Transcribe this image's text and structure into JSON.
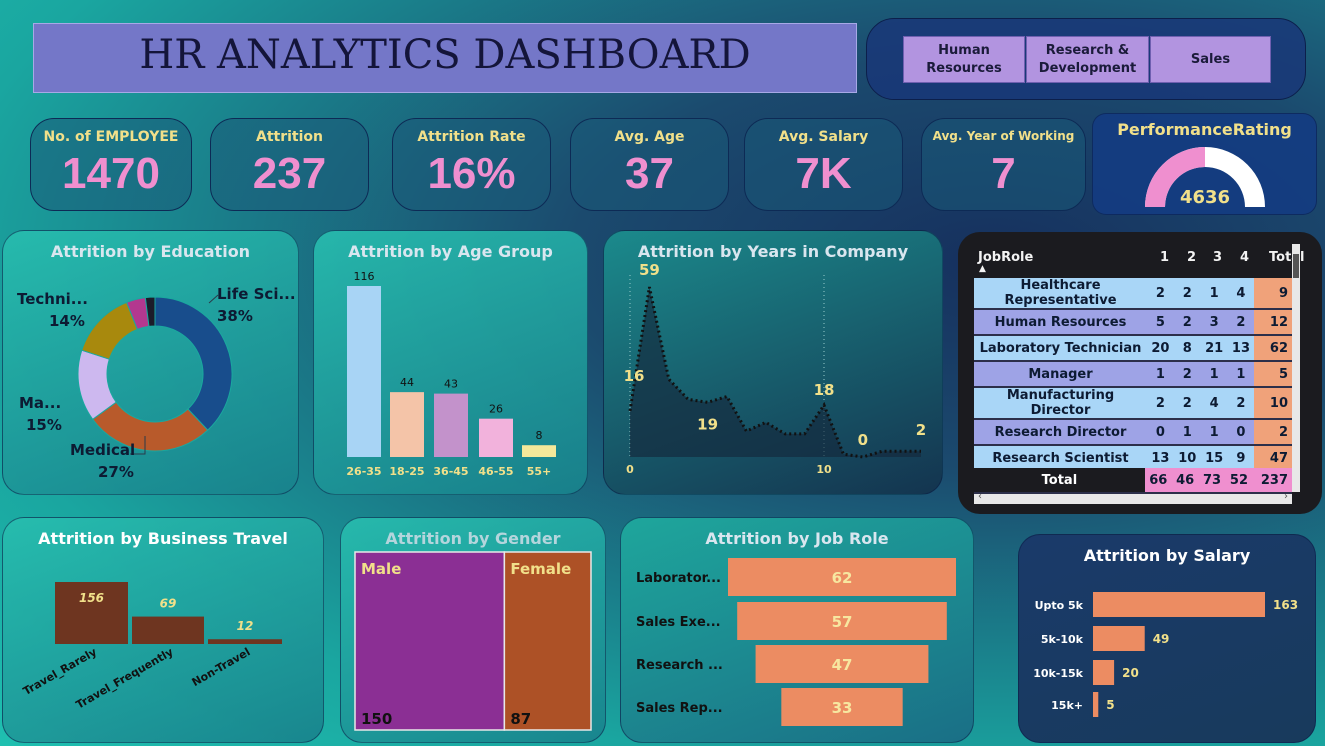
{
  "header": {
    "title": "HR ANALYTICS DASHBOARD"
  },
  "departments": [
    "Human Resources",
    "Research & Development",
    "Sales"
  ],
  "kpis": [
    {
      "label": "No. of EMPLOYEE",
      "value": "1470"
    },
    {
      "label": "Attrition",
      "value": "237"
    },
    {
      "label": "Attrition Rate",
      "value": "16%"
    },
    {
      "label": "Avg. Age",
      "value": "37"
    },
    {
      "label": "Avg. Salary",
      "value": "7K"
    },
    {
      "label": "Avg. Year of Working",
      "value": "7"
    }
  ],
  "performance": {
    "title": "PerformanceRating",
    "value": "4636"
  },
  "colors": {
    "pink": "#ef8fcf",
    "gold": "#f1e08a",
    "orange": "#ec8c62",
    "brown": "#6e3520",
    "purple": "#8b2f94",
    "rust": "#ad5126"
  },
  "chart_data": [
    {
      "id": "education",
      "type": "pie",
      "title": "Attrition by Education",
      "slices": [
        {
          "label": "Life Sci...",
          "pct": "38%",
          "value": 38,
          "color": "#184d8c"
        },
        {
          "label": "Medical",
          "pct": "27%",
          "value": 27,
          "color": "#b85a2b"
        },
        {
          "label": "Ma...",
          "pct": "15%",
          "value": 15,
          "color": "#cdb8ef"
        },
        {
          "label": "Techni...",
          "pct": "14%",
          "value": 14,
          "color": "#a8890d"
        },
        {
          "label": "",
          "value": 4,
          "color": "#b3388f"
        },
        {
          "label": "",
          "value": 2,
          "color": "#1c1c2a"
        }
      ]
    },
    {
      "id": "age",
      "type": "bar",
      "title": "Attrition by Age Group",
      "categories": [
        "26-35",
        "18-25",
        "36-45",
        "46-55",
        "55+"
      ],
      "values": [
        116,
        44,
        43,
        26,
        8
      ],
      "colors": [
        "#a8d4f5",
        "#f4c4a8",
        "#c392cb",
        "#f2b2dc",
        "#f4e89a"
      ]
    },
    {
      "id": "years",
      "type": "area",
      "title": "Attrition by Years in Company",
      "x": [
        0,
        1,
        2,
        3,
        4,
        5,
        6,
        7,
        8,
        9,
        10,
        11,
        12,
        13,
        14,
        15
      ],
      "values": [
        16,
        59,
        27,
        20,
        19,
        21,
        9,
        12,
        8,
        8,
        18,
        1,
        0,
        2,
        2,
        2
      ],
      "labels": [
        "16",
        "59",
        "19",
        "18",
        "0",
        "2"
      ],
      "xticks": [
        "0",
        "10"
      ]
    },
    {
      "id": "travel",
      "type": "bar",
      "title": "Attrition by Business Travel",
      "categories": [
        "Travel_Rarely",
        "Travel_Frequently",
        "Non-Travel"
      ],
      "values": [
        156,
        69,
        12
      ]
    },
    {
      "id": "gender",
      "type": "bar",
      "title": "Attrition by Gender",
      "categories": [
        "Male",
        "Female"
      ],
      "values": [
        150,
        87
      ]
    },
    {
      "id": "jobrole",
      "type": "bar",
      "title": "Attrition by Job Role",
      "categories": [
        "Laborator...",
        "Sales Exe...",
        "Research ...",
        "Sales Rep..."
      ],
      "values": [
        62,
        57,
        47,
        33
      ]
    },
    {
      "id": "salary",
      "type": "bar",
      "title": "Attrition by Salary",
      "categories": [
        "Upto 5k",
        "5k-10k",
        "10k-15k",
        "15k+"
      ],
      "values": [
        163,
        49,
        20,
        5
      ]
    },
    {
      "id": "matrix",
      "type": "table",
      "headers": [
        "JobRole",
        "1",
        "2",
        "3",
        "4",
        "Total"
      ],
      "rows": [
        {
          "role": "Healthcare Representative",
          "v": [
            "2",
            "2",
            "1",
            "4"
          ],
          "total": "9"
        },
        {
          "role": "Human Resources",
          "v": [
            "5",
            "2",
            "3",
            "2"
          ],
          "total": "12"
        },
        {
          "role": "Laboratory Technician",
          "v": [
            "20",
            "8",
            "21",
            "13"
          ],
          "total": "62"
        },
        {
          "role": "Manager",
          "v": [
            "1",
            "2",
            "1",
            "1"
          ],
          "total": "5"
        },
        {
          "role": "Manufacturing Director",
          "v": [
            "2",
            "2",
            "4",
            "2"
          ],
          "total": "10"
        },
        {
          "role": "Research Director",
          "v": [
            "0",
            "1",
            "1",
            "0"
          ],
          "total": "2"
        },
        {
          "role": "Research Scientist",
          "v": [
            "13",
            "10",
            "15",
            "9"
          ],
          "total": "47"
        }
      ],
      "total_row": {
        "label": "Total",
        "v": [
          "66",
          "46",
          "73",
          "52"
        ],
        "total": "237"
      }
    }
  ]
}
